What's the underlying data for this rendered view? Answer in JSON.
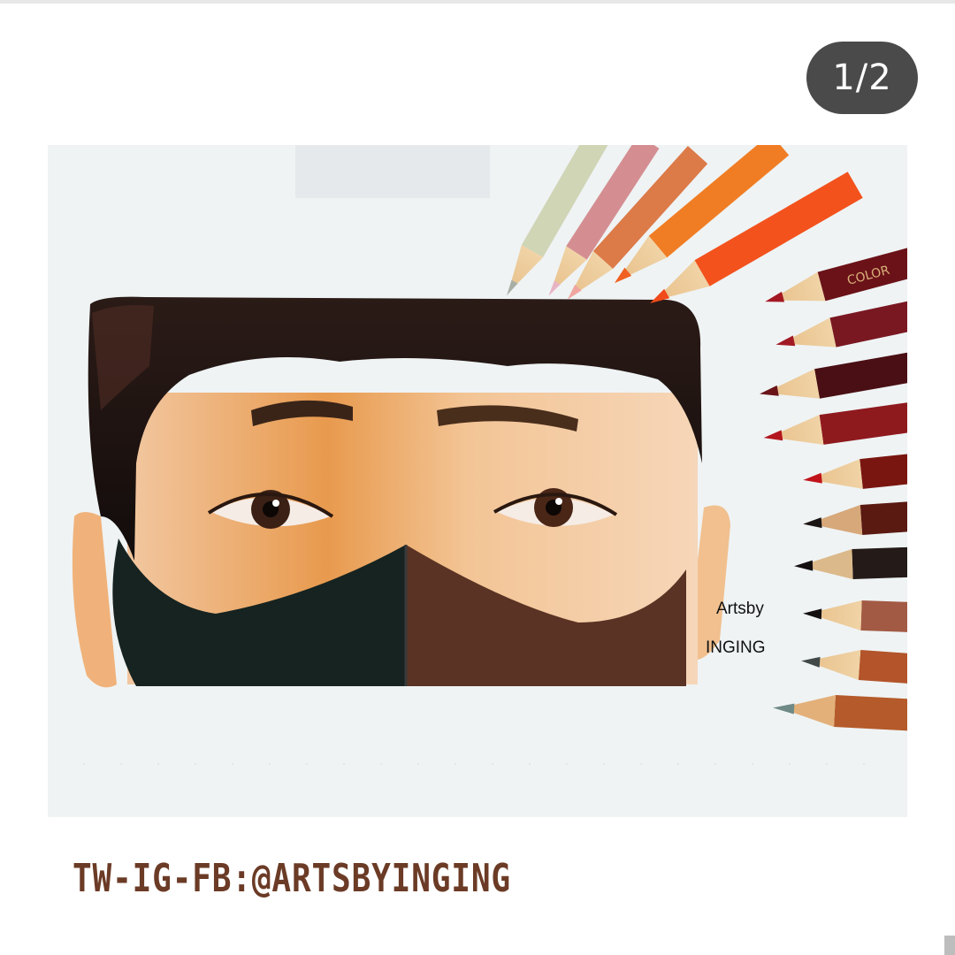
{
  "post": {
    "counter": "1/2",
    "caption": "TW-IG-FB:@ARTSBYINGING"
  },
  "artwork": {
    "signature_line1": "Artsby",
    "signature_line2": "INGING",
    "pencil_brand": "COLOR"
  },
  "colors": {
    "counter_bg": "#4a4a4a",
    "caption_text": "#6b3b26",
    "paper": "#eff3f4"
  }
}
